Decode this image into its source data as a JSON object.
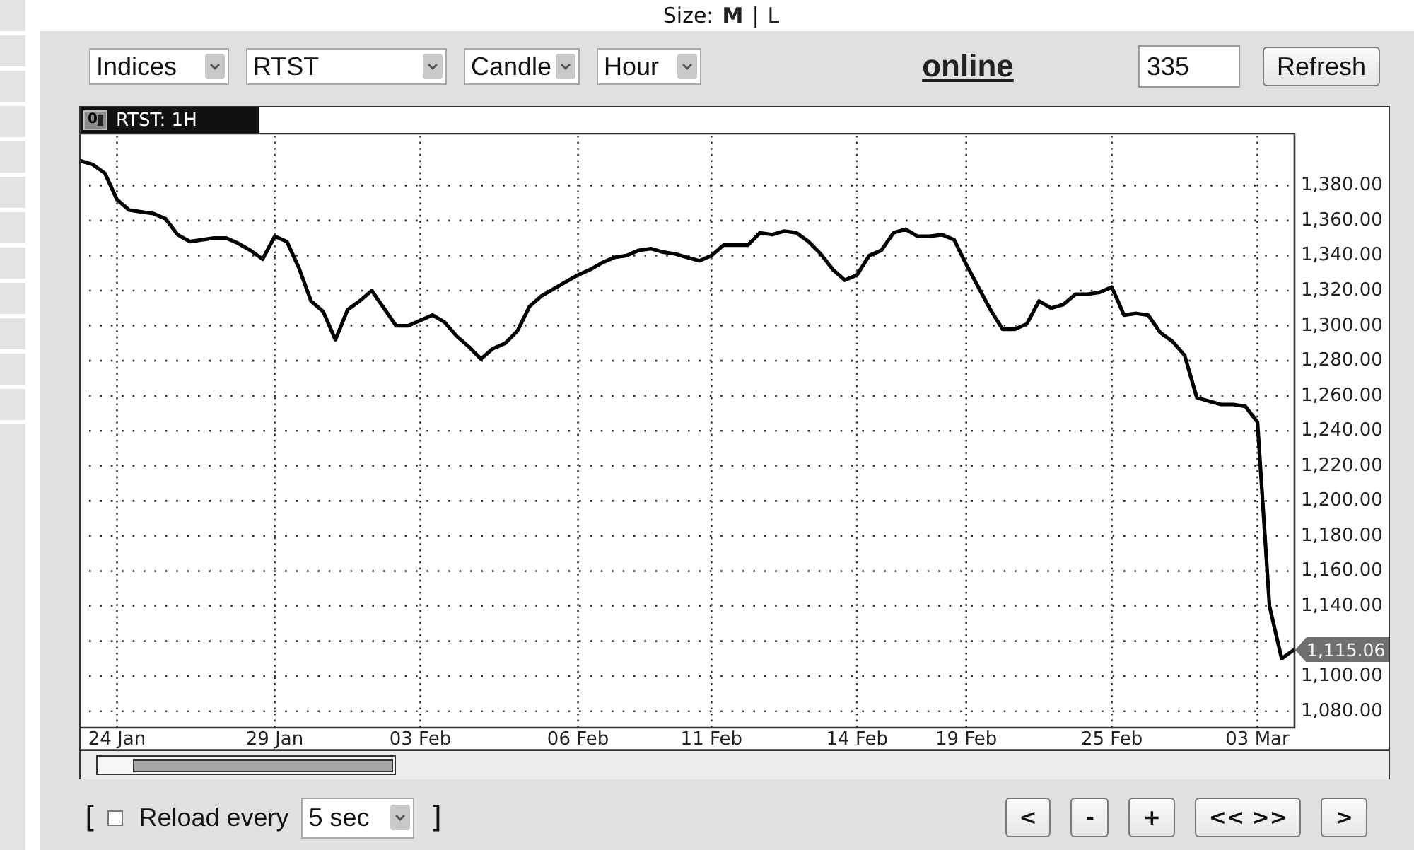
{
  "size_selector": {
    "label": "Size:",
    "separator": "|",
    "options": [
      {
        "label": "M",
        "selected": true
      },
      {
        "label": "L",
        "selected": false
      }
    ]
  },
  "toolbar": {
    "dropdowns": [
      {
        "value": "Indices"
      },
      {
        "value": "RTST"
      },
      {
        "value": "Candle"
      },
      {
        "value": "Hour"
      }
    ],
    "status_link": "online",
    "count_field": {
      "value": "335"
    },
    "refresh_button": "Refresh"
  },
  "chart": {
    "tab_button": "0",
    "chart_data": {
      "type": "line",
      "title": "RTST: 1H",
      "grid": true,
      "ylim": [
        1071,
        1410
      ],
      "yticks": [
        {
          "value": 1080,
          "label": "1,080.00"
        },
        {
          "value": 1100,
          "label": "1,100.00"
        },
        {
          "value": 1140,
          "label": "1,140.00"
        },
        {
          "value": 1160,
          "label": "1,160.00"
        },
        {
          "value": 1180,
          "label": "1,180.00"
        },
        {
          "value": 1200,
          "label": "1,200.00"
        },
        {
          "value": 1220,
          "label": "1,220.00"
        },
        {
          "value": 1240,
          "label": "1,240.00"
        },
        {
          "value": 1260,
          "label": "1,260.00"
        },
        {
          "value": 1280,
          "label": "1,280.00"
        },
        {
          "value": 1300,
          "label": "1,300.00"
        },
        {
          "value": 1320,
          "label": "1,320.00"
        },
        {
          "value": 1340,
          "label": "1,340.00"
        },
        {
          "value": 1360,
          "label": "1,360.00"
        },
        {
          "value": 1380,
          "label": "1,380.00"
        }
      ],
      "categories": [
        null,
        null,
        null,
        "24 Jan",
        null,
        null,
        null,
        null,
        null,
        null,
        null,
        null,
        null,
        null,
        null,
        null,
        "29 Jan",
        null,
        null,
        null,
        null,
        null,
        null,
        null,
        null,
        null,
        null,
        null,
        "03 Feb",
        null,
        null,
        null,
        null,
        null,
        null,
        null,
        null,
        null,
        null,
        null,
        null,
        "06 Feb",
        null,
        null,
        null,
        null,
        null,
        null,
        null,
        null,
        null,
        null,
        "11 Feb",
        null,
        null,
        null,
        null,
        null,
        null,
        null,
        null,
        null,
        null,
        null,
        "14 Feb",
        null,
        null,
        null,
        null,
        null,
        null,
        null,
        null,
        "19 Feb",
        null,
        null,
        null,
        null,
        null,
        null,
        null,
        null,
        null,
        null,
        null,
        "25 Feb",
        null,
        null,
        null,
        null,
        null,
        null,
        null,
        null,
        null,
        null,
        null,
        "03 Mar",
        null,
        null,
        null
      ],
      "series": [
        {
          "color": "#000000",
          "values": [
            1394,
            1392,
            1387,
            1372,
            1366,
            1365,
            1364,
            1361,
            1352,
            1348,
            1349,
            1350,
            1350,
            1347,
            1343,
            1338,
            1351,
            1348,
            1333,
            1314,
            1308,
            1292,
            1309,
            1314,
            1320,
            1310,
            1300,
            1300,
            1303,
            1306,
            1302,
            1294,
            1288,
            1281,
            1287,
            1290,
            1297,
            1311,
            1317,
            1321,
            1325,
            1329,
            1332,
            1336,
            1339,
            1340,
            1343,
            1344,
            1342,
            1341,
            1339,
            1337,
            1340,
            1346,
            1346,
            1346,
            1353,
            1352,
            1354,
            1353,
            1348,
            1341,
            1332,
            1326,
            1329,
            1340,
            1343,
            1353,
            1355,
            1351,
            1351,
            1352,
            1349,
            1335,
            1322,
            1309,
            1298,
            1298,
            1301,
            1314,
            1310,
            1312,
            1318,
            1318,
            1319,
            1322,
            1306,
            1307,
            1306,
            1296,
            1291,
            1283,
            1259,
            1257,
            1255,
            1255,
            1254,
            1245,
            1140,
            1110,
            1115
          ]
        }
      ],
      "annotations": [
        "1,115.06"
      ]
    }
  },
  "footer": {
    "bracket_open": "[",
    "reload_checkbox": {
      "label": "Reload every",
      "checked": false
    },
    "interval_dropdown": {
      "value": "5 sec"
    },
    "bracket_close": "]",
    "nav_buttons": [
      "<",
      "-",
      "+",
      "<< >>",
      ">"
    ]
  }
}
